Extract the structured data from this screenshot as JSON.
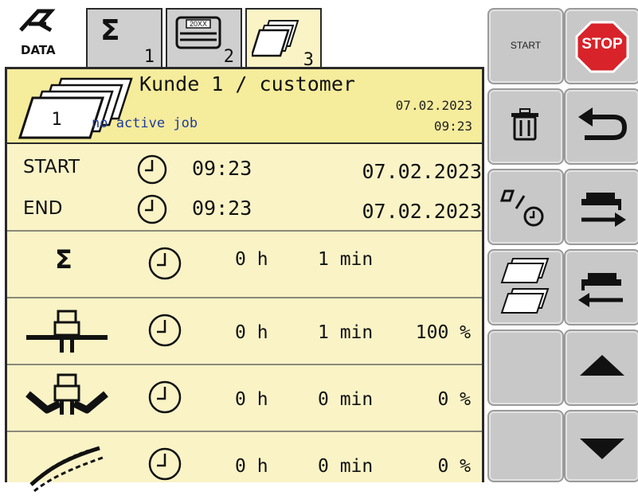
{
  "logo": {
    "label": "DATA"
  },
  "tabs": [
    {
      "icon": "sigma-icon",
      "symbol": "Σ",
      "number": "1"
    },
    {
      "icon": "counter-display-icon",
      "display_text": "20XX",
      "number": "2"
    },
    {
      "icon": "job-stack-icon",
      "number": "3",
      "active": true
    }
  ],
  "header": {
    "customer": "Kunde 1 / customer",
    "job_number": "1",
    "job_status": "no active job",
    "date": "07.02.2023",
    "time": "09:23"
  },
  "start_row": {
    "label": "START",
    "time": "09:23",
    "date": "07.02.2023"
  },
  "end_row": {
    "label": "END",
    "time": "09:23",
    "date": "07.02.2023"
  },
  "stats": [
    {
      "name": "total",
      "icon": "sigma-icon",
      "symbol": "Σ",
      "hours": "0 h",
      "minutes": "1 min",
      "percent": ""
    },
    {
      "name": "working-position",
      "icon": "implement-lowered-icon",
      "hours": "0 h",
      "minutes": "1 min",
      "percent": "100 %"
    },
    {
      "name": "headland-position",
      "icon": "implement-raised-icon",
      "hours": "0 h",
      "minutes": "0 min",
      "percent": "0 %"
    },
    {
      "name": "field-transport",
      "icon": "field-swath-icon",
      "hours": "0 h",
      "minutes": "0 min",
      "percent": "0 %"
    }
  ],
  "buttons": {
    "start_label": "START",
    "stop_label": "STOP"
  },
  "colors": {
    "panel_bg": "#f9f3c6",
    "header_bg": "#f5ec9c",
    "button_bg": "#c8c8c8",
    "stop_red": "#d8232a",
    "status_blue": "#1f3a9e"
  }
}
